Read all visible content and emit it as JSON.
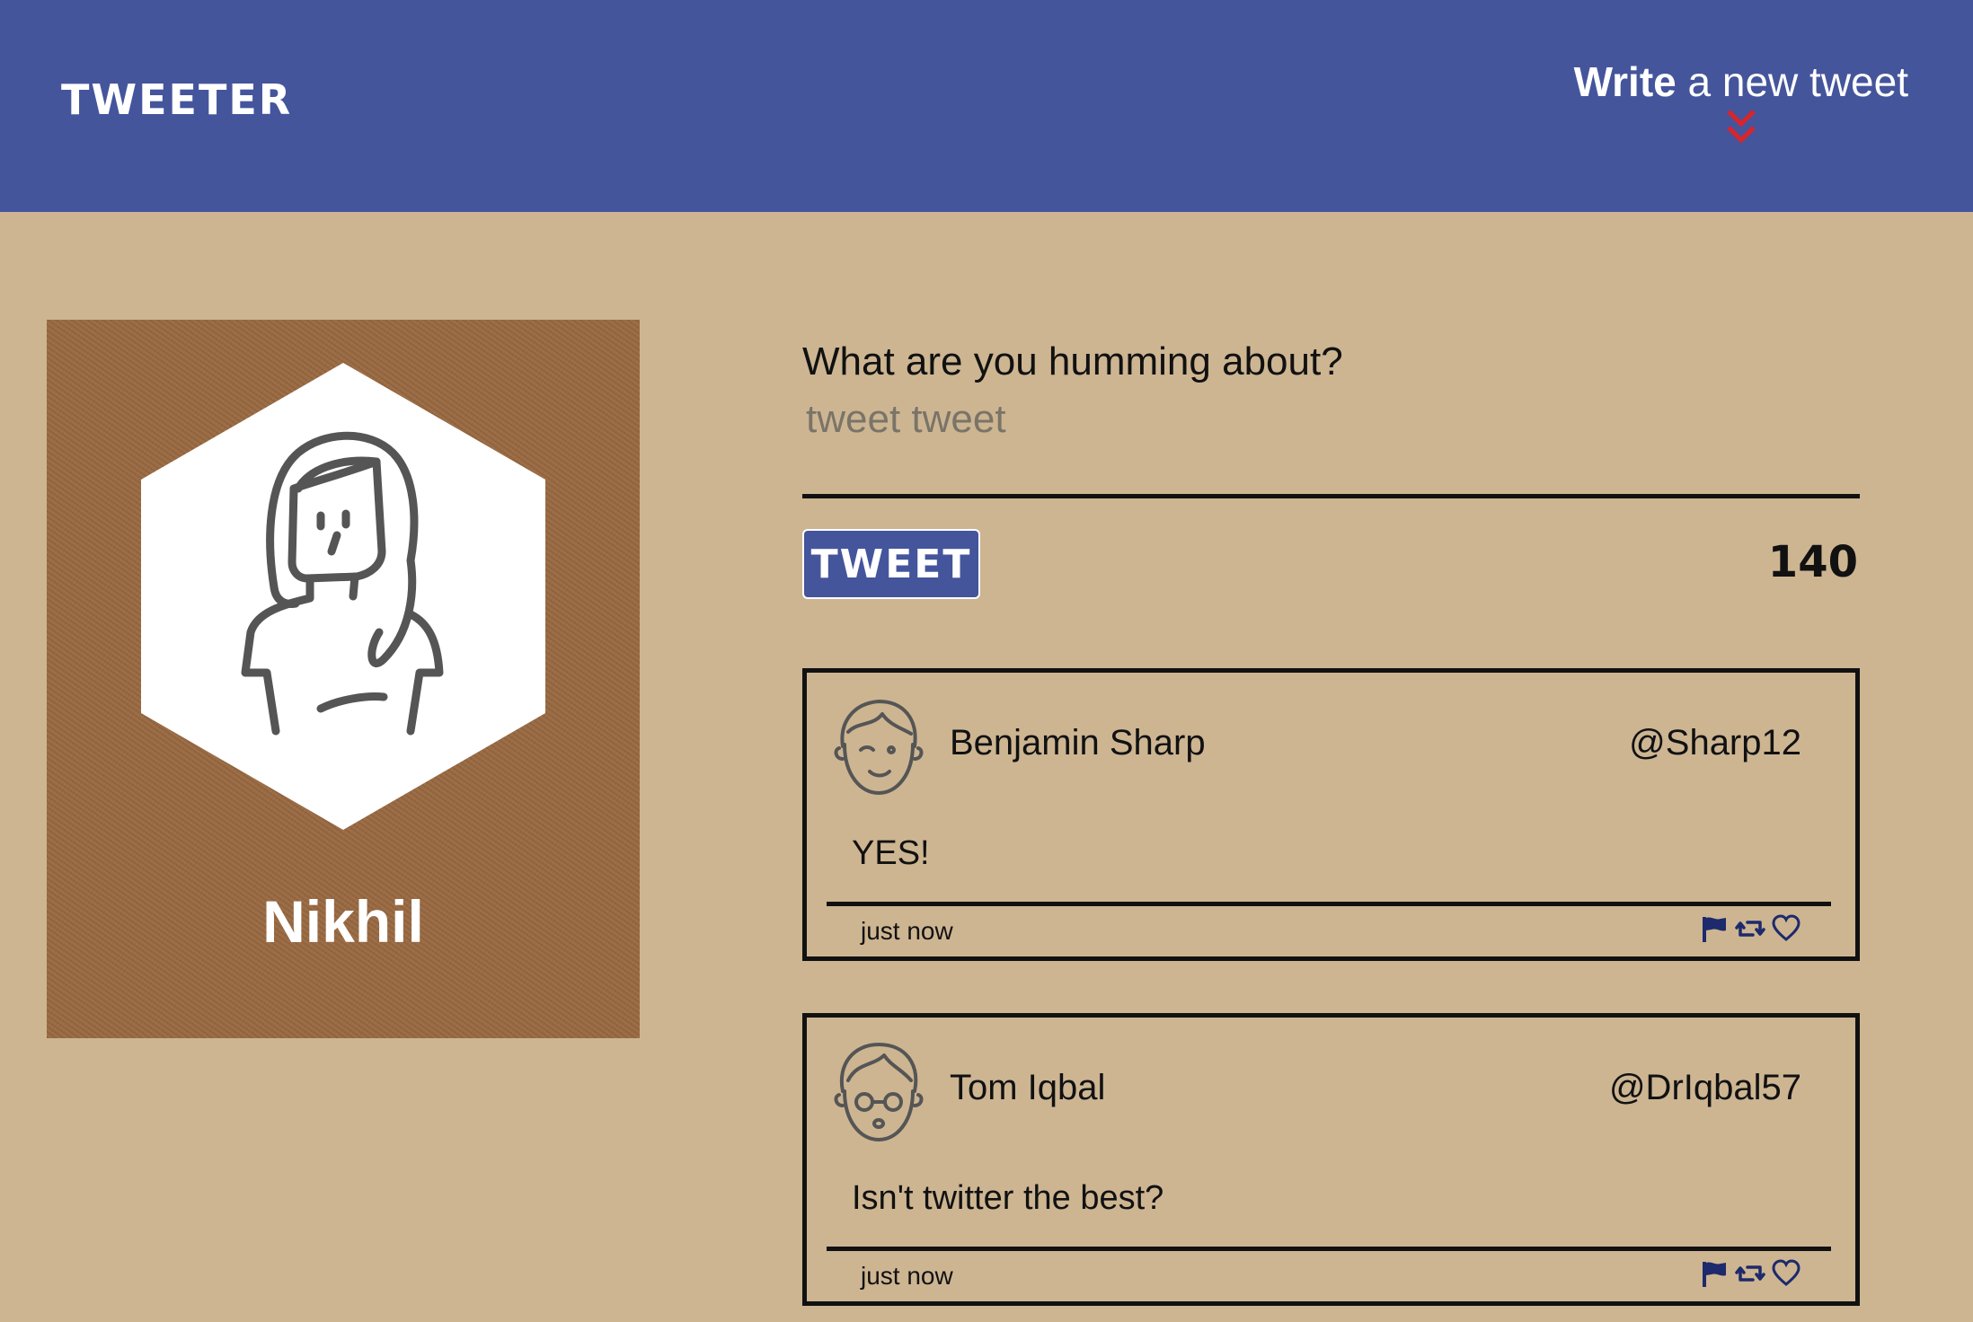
{
  "nav": {
    "brand": "TWEETER",
    "compose_strong": "Write",
    "compose_rest": " a new tweet",
    "chevron_color": "#d8242a"
  },
  "profile": {
    "name": "Nikhil",
    "avatar_icon": "woman-avatar-icon"
  },
  "composer": {
    "prompt": "What are you humming about?",
    "placeholder": "tweet tweet",
    "submit_label": "TWEET",
    "counter": "140"
  },
  "tweets": [
    {
      "name": "Benjamin Sharp",
      "handle": "@Sharp12",
      "content": "YES!",
      "time": "just now",
      "avatar_icon": "winking-man-avatar-icon"
    },
    {
      "name": "Tom Iqbal",
      "handle": "@DrIqbal57",
      "content": "Isn't twitter the best?",
      "time": "just now",
      "avatar_icon": "man-with-glasses-avatar-icon"
    }
  ],
  "actions": [
    "flag-icon",
    "retweet-icon",
    "heart-icon"
  ],
  "colors": {
    "nav": "#45559c",
    "background": "#cdb592",
    "profile_card": "#9a6a42",
    "action_icons": "#1d2a6b"
  }
}
